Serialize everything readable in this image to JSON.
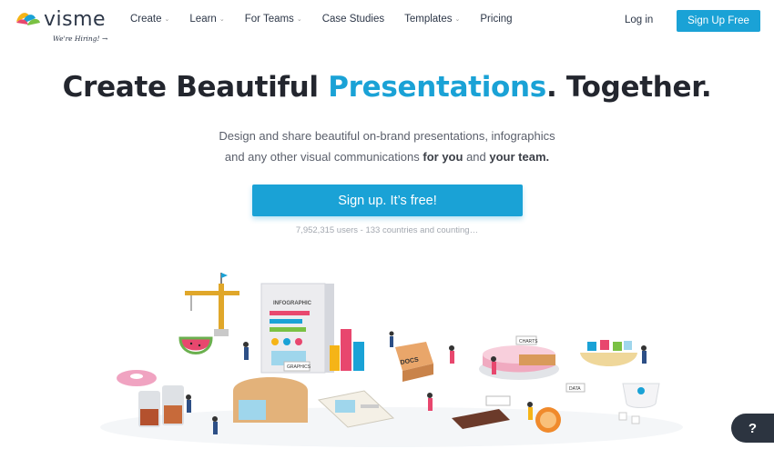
{
  "brand": {
    "name": "visme",
    "hiring": "We're Hiring! →",
    "accent": "#1aa2d6"
  },
  "nav": {
    "items": [
      {
        "label": "Create",
        "dropdown": true
      },
      {
        "label": "Learn",
        "dropdown": true
      },
      {
        "label": "For Teams",
        "dropdown": true
      },
      {
        "label": "Case Studies",
        "dropdown": false
      },
      {
        "label": "Templates",
        "dropdown": true
      },
      {
        "label": "Pricing",
        "dropdown": false
      }
    ],
    "login": "Log in",
    "signup": "Sign Up Free"
  },
  "hero": {
    "headline_pre": "Create Beautiful",
    "headline_accent": "Presentations",
    "headline_post": ". Together.",
    "sub_line1": "Design and share beautiful on-brand presentations, infographics",
    "sub_line2_pre": "and any other visual communications",
    "sub_bold1": "for you",
    "sub_mid": "and",
    "sub_bold2": "your team.",
    "cta": "Sign up. It’s free!",
    "counter": "7,952,315 users - 133 countries and counting…"
  },
  "illustration": {
    "infographic_label": "INFOGRAPHIC",
    "graphics_label": "GRAPHICS",
    "docs_label": "DOCS",
    "charts_label": "CHARTS",
    "data_label": "DATA"
  },
  "help": {
    "label": "?"
  }
}
